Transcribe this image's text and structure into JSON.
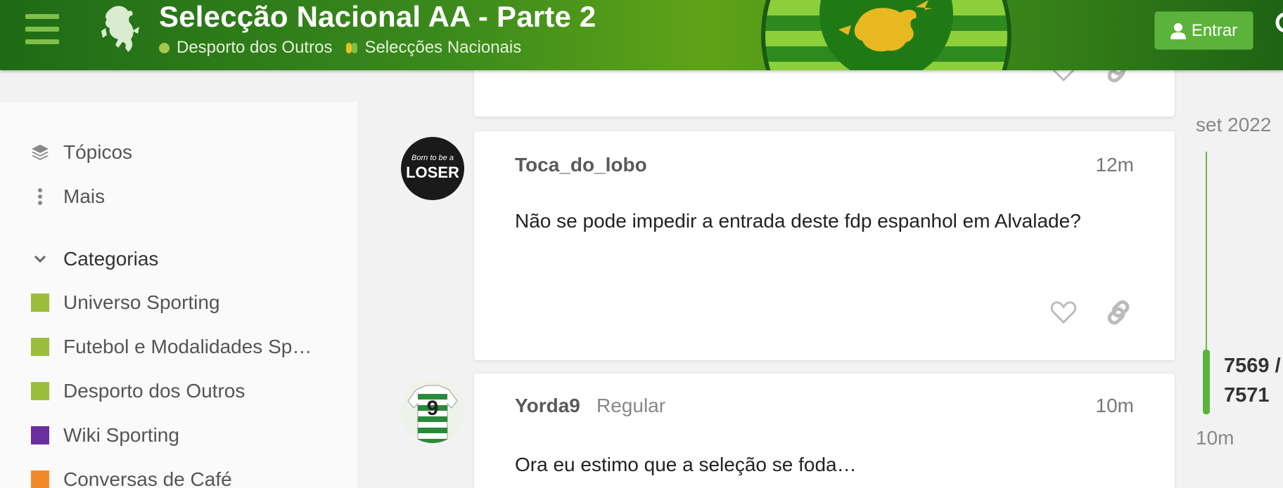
{
  "header": {
    "topic_title": "Selecção Nacional AA - Parte 2",
    "breadcrumbs": [
      {
        "label": "Desporto dos Outros",
        "color": "#a6c84a"
      },
      {
        "label": "Selecções Nacionais",
        "colors": [
          "#e3c21c",
          "#7cc14a"
        ]
      }
    ],
    "login_label": "Entrar",
    "colors": {
      "header_green": "#2f7d18",
      "button_green": "#5cb33b"
    }
  },
  "sidebar": {
    "nav": [
      {
        "label": "Tópicos",
        "icon": "layers-icon"
      },
      {
        "label": "Mais",
        "icon": "vertical-ellipsis-icon"
      }
    ],
    "categories_heading": "Categorias",
    "categories": [
      {
        "label": "Universo Sporting",
        "color": "#9bbd3c"
      },
      {
        "label": "Futebol e Modalidades Sp…",
        "color": "#9bbd3c"
      },
      {
        "label": "Desporto dos Outros",
        "color": "#9bbd3c"
      },
      {
        "label": "Wiki Sporting",
        "color": "#6a2ea0"
      },
      {
        "label": "Conversas de Café",
        "color": "#f28a2a"
      }
    ]
  },
  "posts": [
    {
      "username": "Toca_do_lobo",
      "avatar_text_top": "Born to be a",
      "avatar_text_main": "LOSER",
      "time": "12m",
      "body": "Não se pode impedir a entrada deste fdp espanhol em Alvalade?"
    },
    {
      "username": "Yorda9",
      "title": "Regular",
      "avatar_number": "9",
      "time": "10m",
      "body": "Ora eu estimo que a seleção se foda…"
    }
  ],
  "timeline": {
    "date": "set 2022",
    "position_current": "7569 /",
    "position_total": "7571",
    "ago": "10m"
  }
}
